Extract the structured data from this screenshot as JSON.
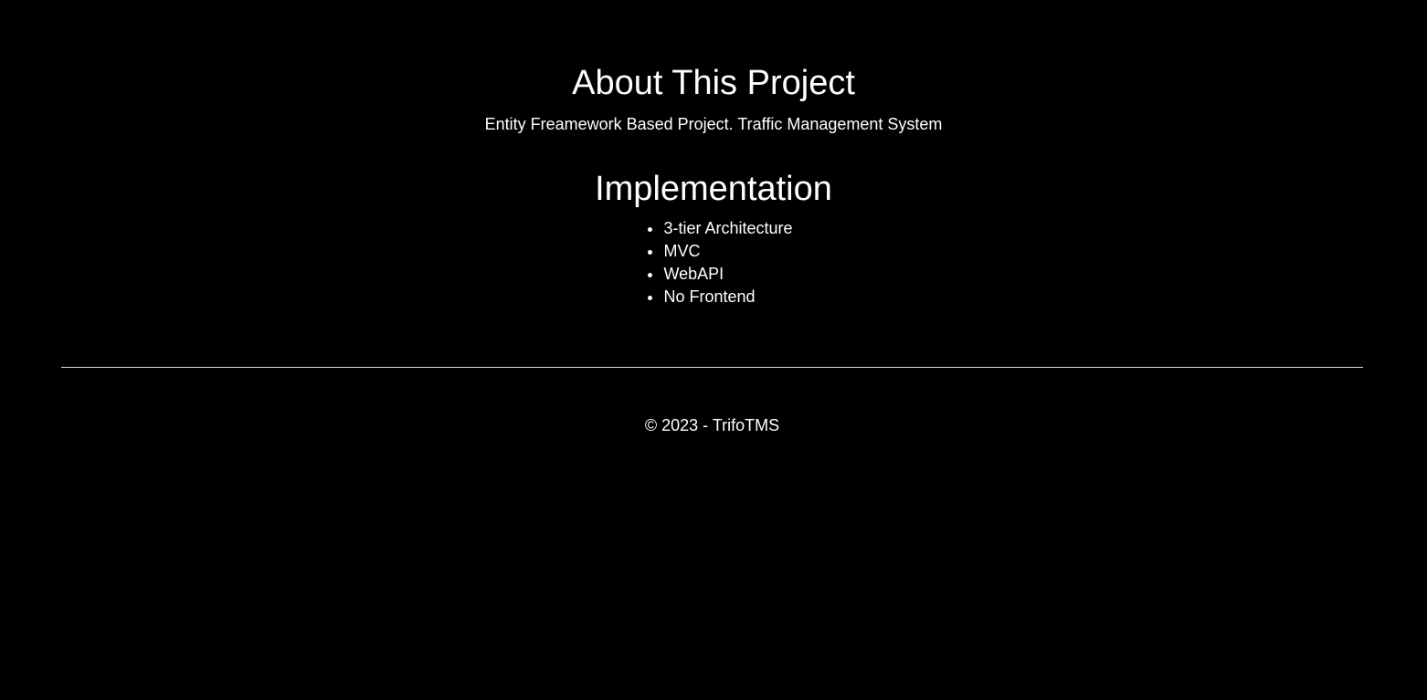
{
  "about": {
    "title": "About This Project",
    "description": "Entity Freamework Based Project. Traffic Management System"
  },
  "implementation": {
    "title": "Implementation",
    "items": [
      "3-tier Architecture",
      "MVC",
      "WebAPI",
      "No Frontend"
    ]
  },
  "footer": {
    "text": "© 2023 - TrifoTMS"
  },
  "colors": {
    "background": "#000000",
    "text": "#ffffff",
    "divider": "#dcdcdc"
  }
}
